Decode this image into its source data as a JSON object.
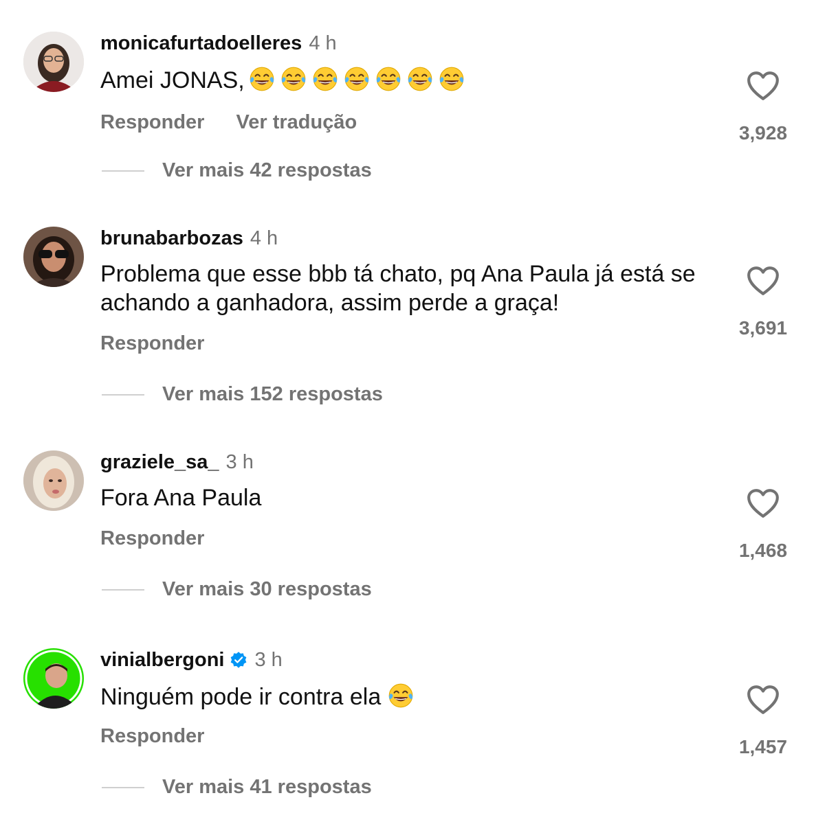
{
  "comments": [
    {
      "username": "monicafurtadoelleres",
      "time": "4 h",
      "text": "Amei JONAS,",
      "emoji_count": 7,
      "reply_label": "Responder",
      "translate_label": "Ver tradução",
      "likes": "3,928",
      "more_replies": "Ver mais 42 respostas",
      "avatar_bg": "#e8e4e2"
    },
    {
      "username": "brunabarbozas",
      "time": "4 h",
      "text": "Problema que esse bbb tá chato, pq Ana Paula já está se achando a ganhadora, assim perde a graça!",
      "emoji_count": 0,
      "reply_label": "Responder",
      "likes": "3,691",
      "more_replies": "Ver mais 152 respostas",
      "avatar_bg": "#8a6a58"
    },
    {
      "username": "graziele_sa_",
      "time": "3 h",
      "text": "Fora Ana Paula",
      "emoji_count": 0,
      "reply_label": "Responder",
      "likes": "1,468",
      "more_replies": "Ver mais 30 respostas",
      "avatar_bg": "#d9c8b8"
    },
    {
      "username": "vinialbergoni",
      "verified": true,
      "time": "3 h",
      "text": "Ninguém pode ir contra ela",
      "emoji_count": 1,
      "reply_label": "Responder",
      "likes": "1,457",
      "more_replies": "Ver mais 41 respostas",
      "avatar_bg": "#27e000"
    }
  ],
  "icons": {
    "like": "heart-outline-icon",
    "verified": "verified-badge-icon",
    "emoji": "tears-of-joy-emoji"
  },
  "colors": {
    "secondary_text": "#737373",
    "verified_blue": "#0095f6"
  }
}
